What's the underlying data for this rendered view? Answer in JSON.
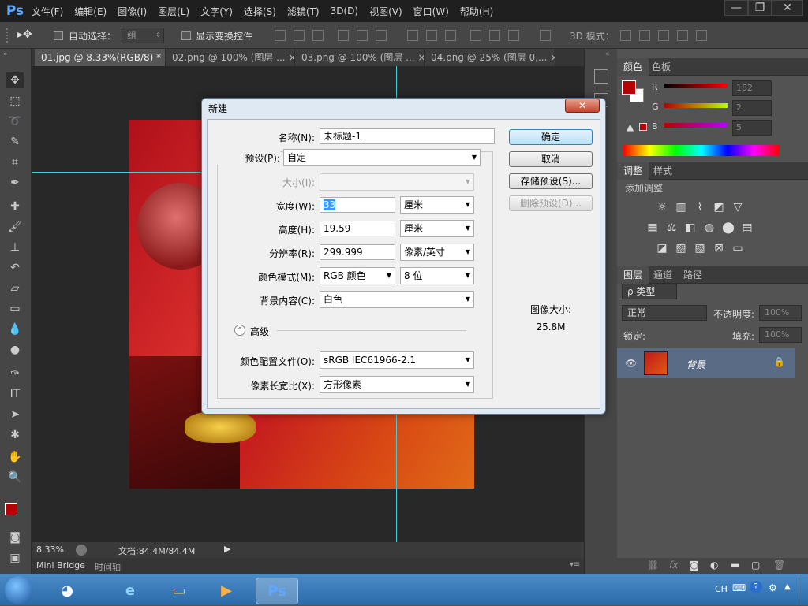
{
  "app": {
    "logo": "Ps"
  },
  "menu": [
    "文件(F)",
    "编辑(E)",
    "图像(I)",
    "图层(L)",
    "文字(Y)",
    "选择(S)",
    "滤镜(T)",
    "3D(D)",
    "视图(V)",
    "窗口(W)",
    "帮助(H)"
  ],
  "window_controls": {
    "minimize": "—",
    "restore": "❐",
    "close": "✕"
  },
  "options_bar": {
    "auto_select_label": "自动选择：",
    "auto_select_value": "组",
    "show_transform_label": "显示变换控件",
    "mode_3d_label": "3D 模式："
  },
  "tabs": [
    {
      "label": "01.jpg @ 8.33%(RGB/8) *",
      "active": true
    },
    {
      "label": "02.png @ 100% (图层 ...",
      "active": false
    },
    {
      "label": "03.png @ 100% (图层 ...",
      "active": false
    },
    {
      "label": "04.png @ 25% (图层 0,...",
      "active": false
    }
  ],
  "status": {
    "zoom": "8.33%",
    "doc": "文档:84.4M/84.4M"
  },
  "bottom_tabs": [
    "Mini Bridge",
    "时间轴"
  ],
  "color_panel": {
    "tabs": [
      "颜色",
      "色板"
    ],
    "r_label": "R",
    "g_label": "G",
    "b_label": "B",
    "r": "182",
    "g": "2",
    "b": "5",
    "fg_color": "#b60205"
  },
  "adjust_panel": {
    "tabs": [
      "调整",
      "样式"
    ],
    "title": "添加调整"
  },
  "layers_panel": {
    "tabs": [
      "图层",
      "通道",
      "路径"
    ],
    "filter_label": "ρ 类型",
    "blend_mode": "正常",
    "opacity_label": "不透明度:",
    "opacity_value": "100%",
    "lock_label": "锁定:",
    "fill_label": "填充:",
    "fill_value": "100%",
    "layer_name": "背景"
  },
  "dialog": {
    "title": "新建",
    "close": "✕",
    "name_label": "名称(N):",
    "name_value": "未标题-1",
    "preset_label": "预设(P):",
    "preset_value": "自定",
    "size_label": "大小(I):",
    "width_label": "宽度(W):",
    "width_value": "33",
    "width_unit": "厘米",
    "height_label": "高度(H):",
    "height_value": "19.59",
    "height_unit": "厘米",
    "resolution_label": "分辨率(R):",
    "resolution_value": "299.999",
    "resolution_unit": "像素/英寸",
    "color_mode_label": "颜色模式(M):",
    "color_mode_value": "RGB 颜色",
    "bit_depth": "8 位",
    "bg_label": "背景内容(C):",
    "bg_value": "白色",
    "advanced_label": "高级",
    "profile_label": "颜色配置文件(O):",
    "profile_value": "sRGB IEC61966-2.1",
    "pixel_aspect_label": "像素长宽比(X):",
    "pixel_aspect_value": "方形像素",
    "ok": "确定",
    "cancel": "取消",
    "save_preset": "存储预设(S)...",
    "delete_preset": "删除预设(D)...",
    "image_size_label": "图像大小:",
    "image_size_value": "25.8M"
  },
  "taskbar": {
    "lang": "CH"
  }
}
